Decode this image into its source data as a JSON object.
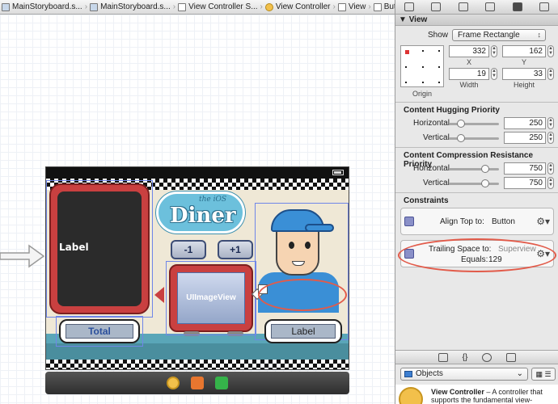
{
  "jumpbar": {
    "crumbs": [
      "MainStoryboard.s...",
      "MainStoryboard.s...",
      "View Controller S...",
      "View Controller",
      "View",
      "Button"
    ]
  },
  "scene": {
    "board_label": "Label",
    "logo_small": "the iOS",
    "logo_big": "Diner",
    "minus_label": "-1",
    "plus_label": "+1",
    "image_view_label": "UIImageView",
    "total_label": "Total",
    "price_label": "Label"
  },
  "inspector": {
    "section_view": "View",
    "show_label": "Show",
    "show_value": "Frame Rectangle",
    "x_value": "332",
    "y_value": "162",
    "width_value": "19",
    "height_value": "33",
    "x_caption": "X",
    "y_caption": "Y",
    "width_caption": "Width",
    "height_caption": "Height",
    "origin_caption": "Origin",
    "hugging_title": "Content Hugging Priority",
    "hugging_h_label": "Horizontal",
    "hugging_h_value": "250",
    "hugging_v_label": "Vertical",
    "hugging_v_value": "250",
    "compression_title": "Content Compression Resistance Priority",
    "compression_h_label": "Horizontal",
    "compression_h_value": "750",
    "compression_v_label": "Vertical",
    "compression_v_value": "750",
    "constraints_title": "Constraints",
    "c1_text": "Align Top to:",
    "c1_target": "Button",
    "c2_text": "Trailing Space to:",
    "c2_target": "Superview",
    "c2_equals_label": "Equals:",
    "c2_equals_value": "129",
    "library_filter": "Objects",
    "library_item_title": "View Controller",
    "library_item_desc": " – A controller that supports the fundamental view-"
  }
}
